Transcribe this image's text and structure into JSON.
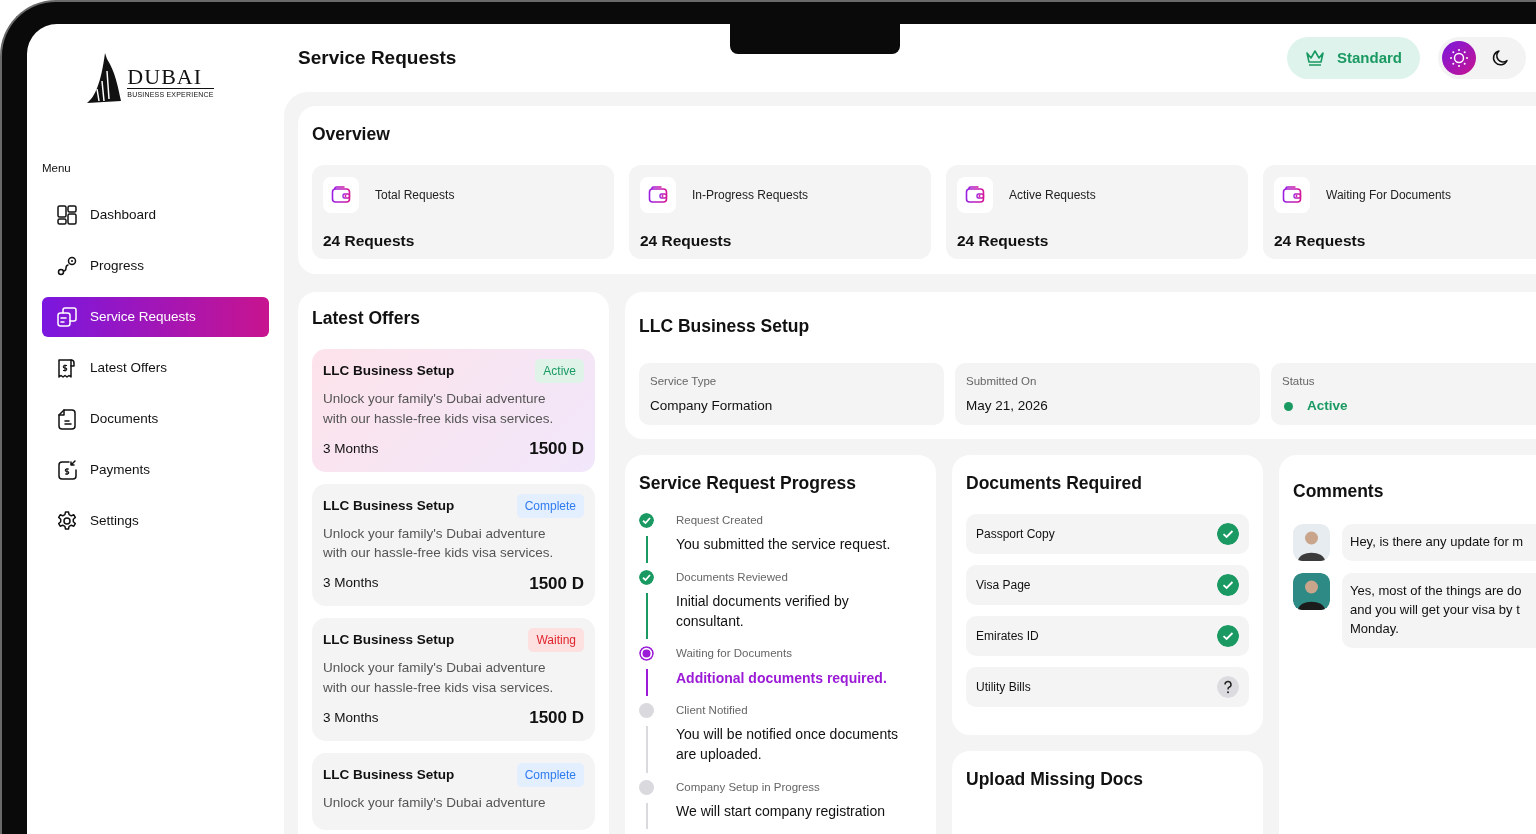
{
  "logo": {
    "name": "DUBAI",
    "tagline": "BUSINESS EXPERIENCE"
  },
  "sidebar": {
    "heading": "Menu",
    "items": [
      {
        "label": "Dashboard",
        "selected": false
      },
      {
        "label": "Progress",
        "selected": false
      },
      {
        "label": "Service Requests",
        "selected": true
      },
      {
        "label": "Latest Offers",
        "selected": false
      },
      {
        "label": "Documents",
        "selected": false
      },
      {
        "label": "Payments",
        "selected": false
      },
      {
        "label": "Settings",
        "selected": false
      }
    ]
  },
  "header": {
    "title": "Service Requests",
    "plan": "Standard",
    "theme_toggle": [
      {
        "kind": "sun",
        "selected": true
      },
      {
        "kind": "moon",
        "selected": false
      }
    ]
  },
  "overview": {
    "title": "Overview",
    "stats": [
      {
        "label": "Total Requests",
        "value": "24 Requests"
      },
      {
        "label": "In-Progress Requests",
        "value": "24 Requests"
      },
      {
        "label": "Active Requests",
        "value": "24 Requests"
      },
      {
        "label": "Waiting For Documents",
        "value": "24 Requests"
      }
    ]
  },
  "latest_offers": {
    "title": "Latest Offers",
    "offers": [
      {
        "title": "LLC Business Setup",
        "status": "Active",
        "kind": "active",
        "highlighted": true,
        "description": "Unlock your family's Dubai adventure with our hassle-free kids visa services.",
        "duration": "3 Months",
        "price": "1500 D"
      },
      {
        "title": "LLC Business Setup",
        "status": "Complete",
        "kind": "complete",
        "highlighted": false,
        "description": "Unlock your family's Dubai adventure with our hassle-free kids visa services.",
        "duration": "3 Months",
        "price": "1500 D"
      },
      {
        "title": "LLC Business Setup",
        "status": "Waiting",
        "kind": "waiting",
        "highlighted": false,
        "description": "Unlock your family's Dubai adventure with our hassle-free kids visa services.",
        "duration": "3 Months",
        "price": "1500 D"
      },
      {
        "title": "LLC Business Setup",
        "status": "Complete",
        "kind": "complete",
        "highlighted": false,
        "description": "Unlock your family's Dubai adventure"
      }
    ]
  },
  "service_request": {
    "title": "LLC Business Setup",
    "fields": [
      {
        "label": "Service Type",
        "value": "Company Formation",
        "kind": "text"
      },
      {
        "label": "Submitted On",
        "value": "May 21, 2026",
        "kind": "text"
      },
      {
        "label": "Status",
        "value": "Active",
        "kind": "status"
      }
    ]
  },
  "progress": {
    "title": "Service Request Progress",
    "steps": [
      {
        "title": "Request Created",
        "description": "You submitted the service request.",
        "completed": true,
        "current": false
      },
      {
        "title": "Documents Reviewed",
        "description": "Initial documents verified by consultant.",
        "completed": true,
        "current": false
      },
      {
        "title": "Waiting for Documents",
        "description": "Additional documents required.",
        "completed": false,
        "current": true
      },
      {
        "title": "Client Notified",
        "description": "You will be notified once documents are uploaded.",
        "completed": false,
        "current": false
      },
      {
        "title": "Company Setup in Progress",
        "description": "We will start company registration",
        "completed": false,
        "current": false
      }
    ]
  },
  "documents": {
    "title": "Documents Required",
    "items": [
      {
        "label": "Passport Copy",
        "uploaded": true
      },
      {
        "label": "Visa Page",
        "uploaded": true
      },
      {
        "label": "Emirates ID",
        "uploaded": true
      },
      {
        "label": "Utility Bills",
        "uploaded": false
      }
    ]
  },
  "upload": {
    "title": "Upload Missing Docs"
  },
  "comments": {
    "title": "Comments",
    "messages": [
      {
        "lines": [
          "Hey, is there any update for m"
        ]
      },
      {
        "lines": [
          "Yes, most of the things are do",
          "and you will get your visa by t",
          "Monday."
        ]
      }
    ]
  }
}
